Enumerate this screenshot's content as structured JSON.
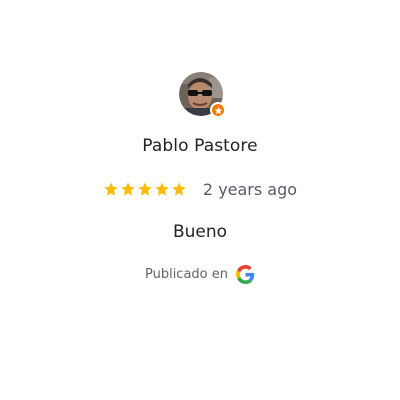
{
  "review": {
    "reviewer_name": "Pablo Pastore",
    "rating": 5,
    "rating_max": 5,
    "time_ago": "2 years ago",
    "text": "Bueno",
    "source_label": "Publicado en",
    "source_icon": "google-icon",
    "badge_icon": "local-guide-star-icon"
  },
  "colors": {
    "star": "#fbbc04",
    "badge": "#f57c00",
    "name_text": "#222222",
    "secondary_text": "#5f6368"
  }
}
